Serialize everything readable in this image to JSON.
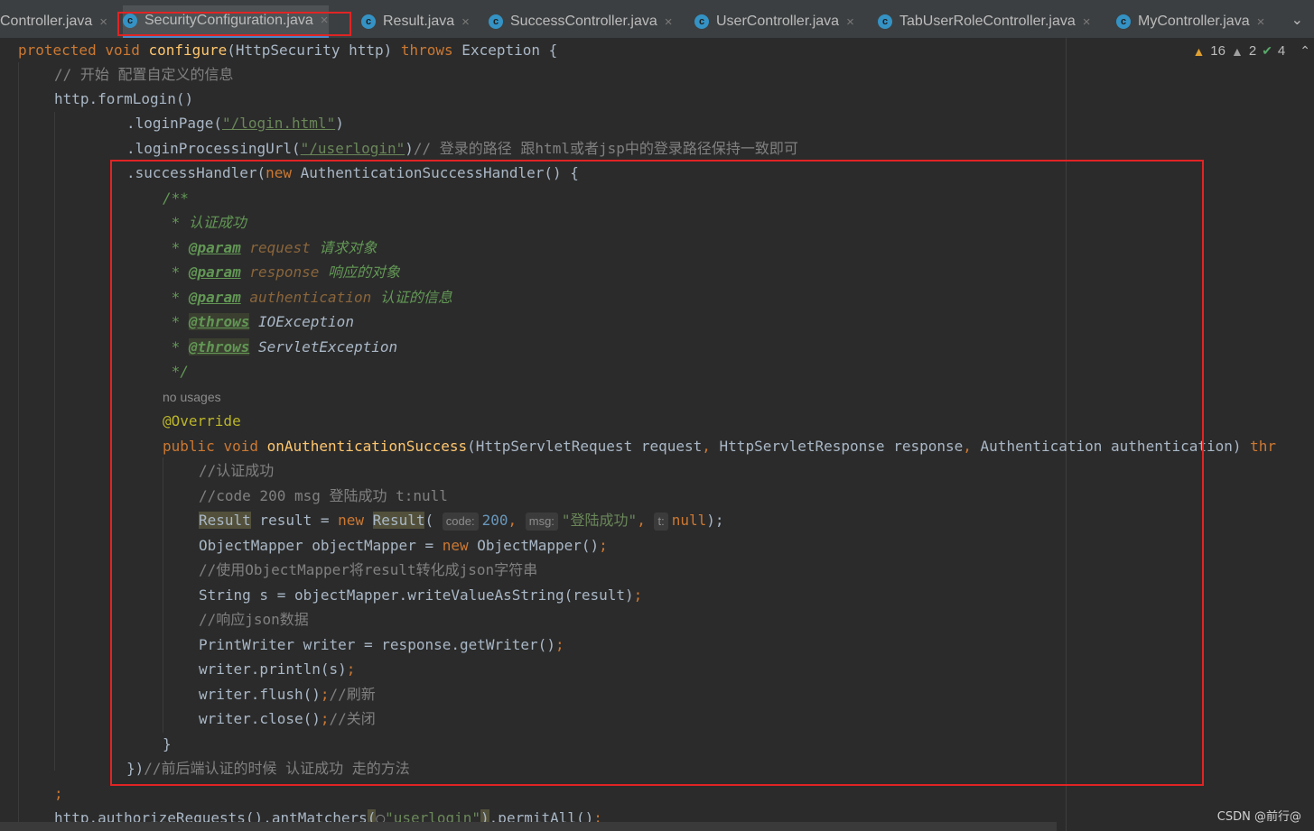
{
  "tabs": [
    {
      "label": "Controller.java",
      "active": false,
      "icon": false
    },
    {
      "label": "SecurityConfiguration.java",
      "active": true,
      "icon": true
    },
    {
      "label": "Result.java",
      "active": false,
      "icon": true
    },
    {
      "label": "SuccessController.java",
      "active": false,
      "icon": true
    },
    {
      "label": "UserController.java",
      "active": false,
      "icon": true
    },
    {
      "label": "TabUserRoleController.java",
      "active": false,
      "icon": true
    },
    {
      "label": "MyController.java",
      "active": false,
      "icon": true
    }
  ],
  "tab_icon_letter": "c",
  "tab_close_glyph": "×",
  "tabs_more_icon": "chevron-down-icon",
  "inspections": {
    "warnings": "16",
    "weak_warnings": "2",
    "typos": "4"
  },
  "code": {
    "l1": {
      "kw1": "protected",
      "kw2": "void",
      "fn": "configure",
      "rest": "(HttpSecurity http) ",
      "kw3": "throws",
      "tail": " Exception {"
    },
    "l2": "// 开始 配置自定义的信息",
    "l3": "http.formLogin()",
    "l4": {
      "pre": ".loginPage(",
      "str": "\"/login.html\"",
      "post": ")"
    },
    "l5": {
      "pre": ".loginProcessingUrl(",
      "str": "\"/userlogin\"",
      "post": ")",
      "cm": "// 登录的路径 跟html或者jsp中的登录路径保持一致即可"
    },
    "l6": {
      "pre": ".successHandler(",
      "kw": "new",
      "post": " AuthenticationSuccessHandler() {"
    },
    "doc_open": "/**",
    "doc_line1": " * 认证成功",
    "doc_star": " * ",
    "param_tag": "@param",
    "throws_tag": "@throws",
    "doc_p1": {
      "name": "request",
      "desc": "请求对象"
    },
    "doc_p2": {
      "name": "response",
      "desc": "响应的对象"
    },
    "doc_p3": {
      "name": "authentication",
      "desc": "认证的信息"
    },
    "doc_t1": "IOException",
    "doc_t2": "ServletException",
    "doc_close": " */",
    "no_usages": "no usages",
    "override": "@Override",
    "sig": {
      "kw1": "public",
      "kw2": "void",
      "fn": "onAuthenticationSuccess",
      "args_a": "(HttpServletRequest request",
      "comma": ",",
      "args_b": " HttpServletResponse response",
      "args_c": " Authentication authentication) ",
      "kw3": "thr"
    },
    "c1": "//认证成功",
    "c2": "//code 200 msg 登陆成功 t:null",
    "res": {
      "type": "Result",
      "mid": " result = ",
      "kw": "new",
      "ctor": "Result",
      "open": "(",
      "h1": "code:",
      "n1": "200",
      "h2": "msg:",
      "s1": "\"登陆成功\"",
      "h3": "t:",
      "null": "null",
      "end": ");"
    },
    "om": {
      "pre": "ObjectMapper objectMapper = ",
      "kw": "new",
      "post": " ObjectMapper()",
      "semi": ";"
    },
    "c3": "//使用ObjectMapper将result转化成json字符串",
    "str_line": {
      "code": "String s = objectMapper.writeValueAsString(result)",
      "semi": ";"
    },
    "c4": "//响应json数据",
    "pw": {
      "code": "PrintWriter writer = response.getWriter()",
      "semi": ";"
    },
    "println": {
      "code": "writer.println(s)",
      "semi": ";"
    },
    "flush": {
      "code": "writer.flush()",
      "semi": ";",
      "cm": "//刷新"
    },
    "close": {
      "code": "writer.close()",
      "semi": ";",
      "cm": "//关闭"
    },
    "brace": "}",
    "end_handler": {
      "code": "})",
      "cm": "//前后端认证的时候 认证成功 走的方法"
    },
    "semi_line": ";",
    "last": {
      "pre": "http.authorizeRequests().antMatchers",
      "open": "(",
      "str": "\"userlogin\"",
      "close": ")",
      "post": ".permitAll()",
      "semi": ";"
    }
  },
  "watermark": "CSDN @前行@",
  "colors": {
    "highlight_box": "#e02424",
    "keyword": "#cc7832",
    "string": "#6a8759",
    "function": "#ffc66d",
    "comment": "#808080",
    "javadoc": "#629755",
    "annotation": "#bbb529",
    "number": "#6897bb",
    "background": "#2b2b2b"
  }
}
